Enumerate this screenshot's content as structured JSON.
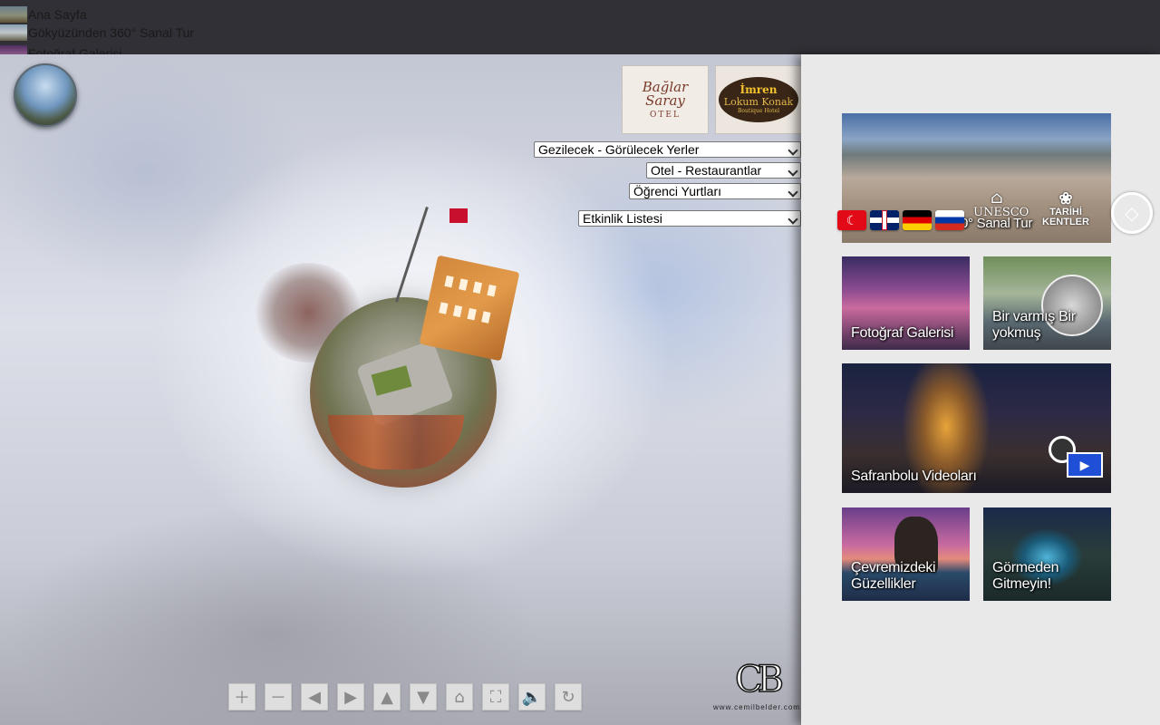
{
  "nav": {
    "items": [
      {
        "label": "Ana Sayfa"
      },
      {
        "label": "Gökyüzünden 360° Sanal Tur"
      },
      {
        "label": "Fotoğraf Galerisi"
      }
    ]
  },
  "pano": {
    "sponsors": [
      {
        "label": "Bağlar Saray Otel",
        "lines": [
          "Bağlar Saray",
          "OTEL"
        ]
      },
      {
        "label": "İmren Lokum Konak",
        "lines": [
          "İmren",
          "Lokum Konak",
          "Boutique Hotel"
        ]
      }
    ],
    "dropdowns": [
      {
        "selected": "Gezilecek - Görülecek Yerler"
      },
      {
        "selected": "Otel - Restaurantlar"
      },
      {
        "selected": "Öğrenci Yurtları"
      },
      {
        "selected": "Etkinlik Listesi"
      }
    ],
    "toolbar": [
      {
        "icon": "zoom-in-icon",
        "glyph": "＋"
      },
      {
        "icon": "zoom-out-icon",
        "glyph": "－"
      },
      {
        "icon": "arrow-left-icon",
        "glyph": "◀"
      },
      {
        "icon": "arrow-right-icon",
        "glyph": "▶"
      },
      {
        "icon": "arrow-up-icon",
        "glyph": "▲"
      },
      {
        "icon": "arrow-down-icon",
        "glyph": "▼"
      },
      {
        "icon": "home-icon",
        "glyph": "⌂"
      },
      {
        "icon": "fullscreen-icon",
        "glyph": "⛶"
      },
      {
        "icon": "sound-icon",
        "glyph": "🔈"
      },
      {
        "icon": "rotate-icon",
        "glyph": "↻"
      }
    ],
    "brand": {
      "mark": "CB",
      "url": "www.cemilbelder.com"
    }
  },
  "panel": {
    "hero_label": "Gökyüzünden 360° Sanal Tur",
    "hero_label_visible": "0° Sanal Tur",
    "unesco": "UNESCO",
    "tarihi": [
      "TARİHİ",
      "KENTLER"
    ],
    "cards": {
      "foto": "Fotoğraf Galerisi",
      "var": "Bir varmış Bir yokmuş",
      "video": "Safranbolu Videoları",
      "cevre": "Çevremizdeki Güzellikler",
      "gor": "Görmeden Gitmeyin!"
    }
  },
  "colors": {
    "topbar": "#303036",
    "panel_bg": "#e9e9e9",
    "flag_tr": "#e30a17"
  }
}
